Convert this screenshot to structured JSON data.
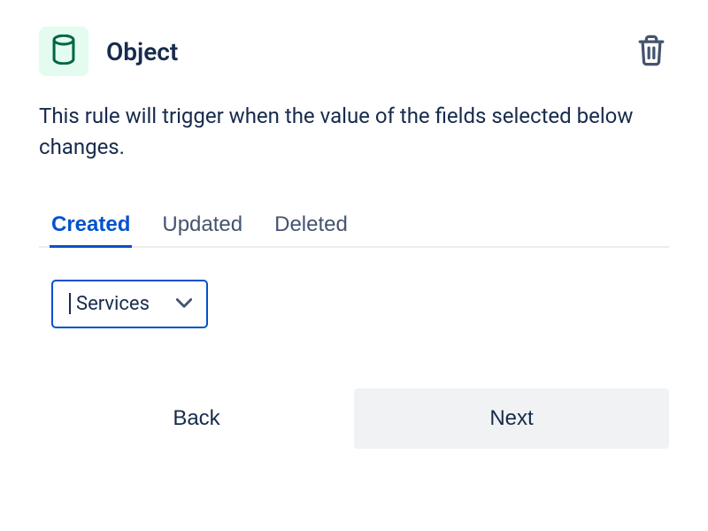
{
  "header": {
    "title": "Object"
  },
  "description": "This rule will trigger when the value of the fields selected below changes.",
  "tabs": [
    {
      "label": "Created",
      "active": true
    },
    {
      "label": "Updated",
      "active": false
    },
    {
      "label": "Deleted",
      "active": false
    }
  ],
  "select": {
    "value": "Services"
  },
  "buttons": {
    "back": "Back",
    "next": "Next"
  }
}
